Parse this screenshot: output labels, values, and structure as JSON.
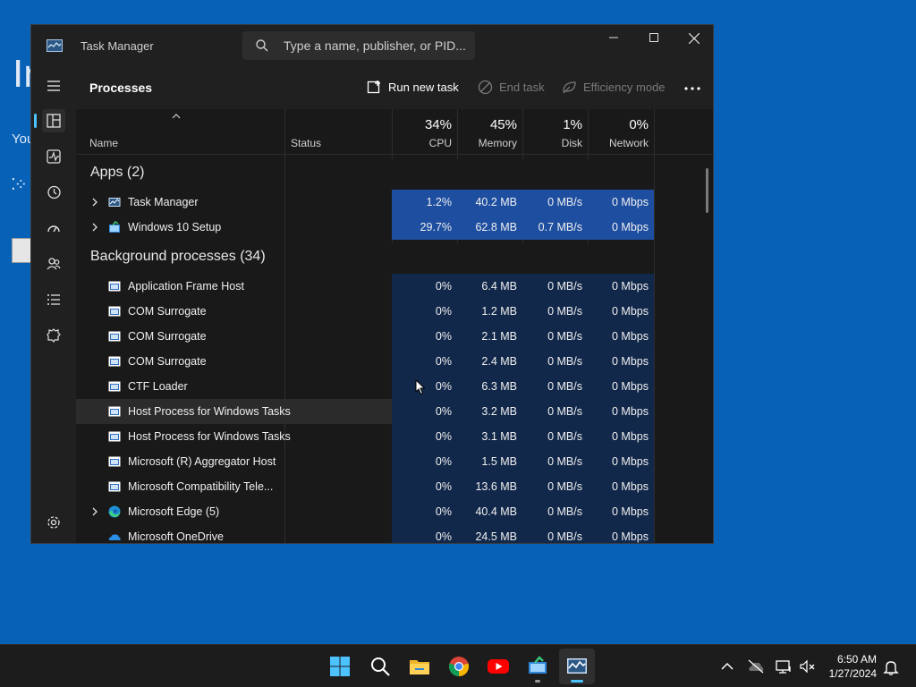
{
  "background": {
    "big_text": "Ir",
    "small_text": "You",
    "dots": "⁚⁘"
  },
  "window": {
    "title": "Task Manager",
    "search_placeholder": "Type a name, publisher, or PID...",
    "page_title": "Processes",
    "toolbar": {
      "run_new_task": "Run new task",
      "end_task": "End task",
      "efficiency_mode": "Efficiency mode"
    },
    "columns": {
      "name": "Name",
      "status": "Status",
      "cpu": {
        "pct": "34%",
        "label": "CPU"
      },
      "memory": {
        "pct": "45%",
        "label": "Memory"
      },
      "disk": {
        "pct": "1%",
        "label": "Disk"
      },
      "network": {
        "pct": "0%",
        "label": "Network"
      }
    },
    "groups": {
      "apps": "Apps (2)",
      "background": "Background processes (34)"
    },
    "apps": [
      {
        "name": "Task Manager",
        "cpu": "1.2%",
        "memory": "40.2 MB",
        "disk": "0 MB/s",
        "network": "0 Mbps",
        "expandable": true,
        "icon": "task-manager-icon"
      },
      {
        "name": "Windows 10 Setup",
        "cpu": "29.7%",
        "memory": "62.8 MB",
        "disk": "0.7 MB/s",
        "network": "0 Mbps",
        "expandable": true,
        "icon": "setup-icon"
      }
    ],
    "background_processes": [
      {
        "name": "Application Frame Host",
        "cpu": "0%",
        "memory": "6.4 MB",
        "disk": "0 MB/s",
        "network": "0 Mbps"
      },
      {
        "name": "COM Surrogate",
        "cpu": "0%",
        "memory": "1.2 MB",
        "disk": "0 MB/s",
        "network": "0 Mbps"
      },
      {
        "name": "COM Surrogate",
        "cpu": "0%",
        "memory": "2.1 MB",
        "disk": "0 MB/s",
        "network": "0 Mbps"
      },
      {
        "name": "COM Surrogate",
        "cpu": "0%",
        "memory": "2.4 MB",
        "disk": "0 MB/s",
        "network": "0 Mbps"
      },
      {
        "name": "CTF Loader",
        "cpu": "0%",
        "memory": "6.3 MB",
        "disk": "0 MB/s",
        "network": "0 Mbps"
      },
      {
        "name": "Host Process for Windows Tasks",
        "cpu": "0%",
        "memory": "3.2 MB",
        "disk": "0 MB/s",
        "network": "0 Mbps",
        "hovered": true
      },
      {
        "name": "Host Process for Windows Tasks",
        "cpu": "0%",
        "memory": "3.1 MB",
        "disk": "0 MB/s",
        "network": "0 Mbps"
      },
      {
        "name": "Microsoft (R) Aggregator Host",
        "cpu": "0%",
        "memory": "1.5 MB",
        "disk": "0 MB/s",
        "network": "0 Mbps"
      },
      {
        "name": "Microsoft Compatibility Tele...",
        "cpu": "0%",
        "memory": "13.6 MB",
        "disk": "0 MB/s",
        "network": "0 Mbps"
      },
      {
        "name": "Microsoft Edge (5)",
        "cpu": "0%",
        "memory": "40.4 MB",
        "disk": "0 MB/s",
        "network": "0 Mbps",
        "expandable": true,
        "icon": "edge-icon"
      },
      {
        "name": "Microsoft OneDrive",
        "cpu": "0%",
        "memory": "24.5 MB",
        "disk": "0 MB/s",
        "network": "0 Mbps",
        "icon": "onedrive-icon"
      }
    ]
  },
  "colors": {
    "accent": "#4cc2ff",
    "heat_high": "#1e4ea0",
    "heat_low": "#12284a",
    "desktop": "#0761b7"
  },
  "taskbar": {
    "time": "6:50 AM",
    "date": "1/27/2024"
  }
}
